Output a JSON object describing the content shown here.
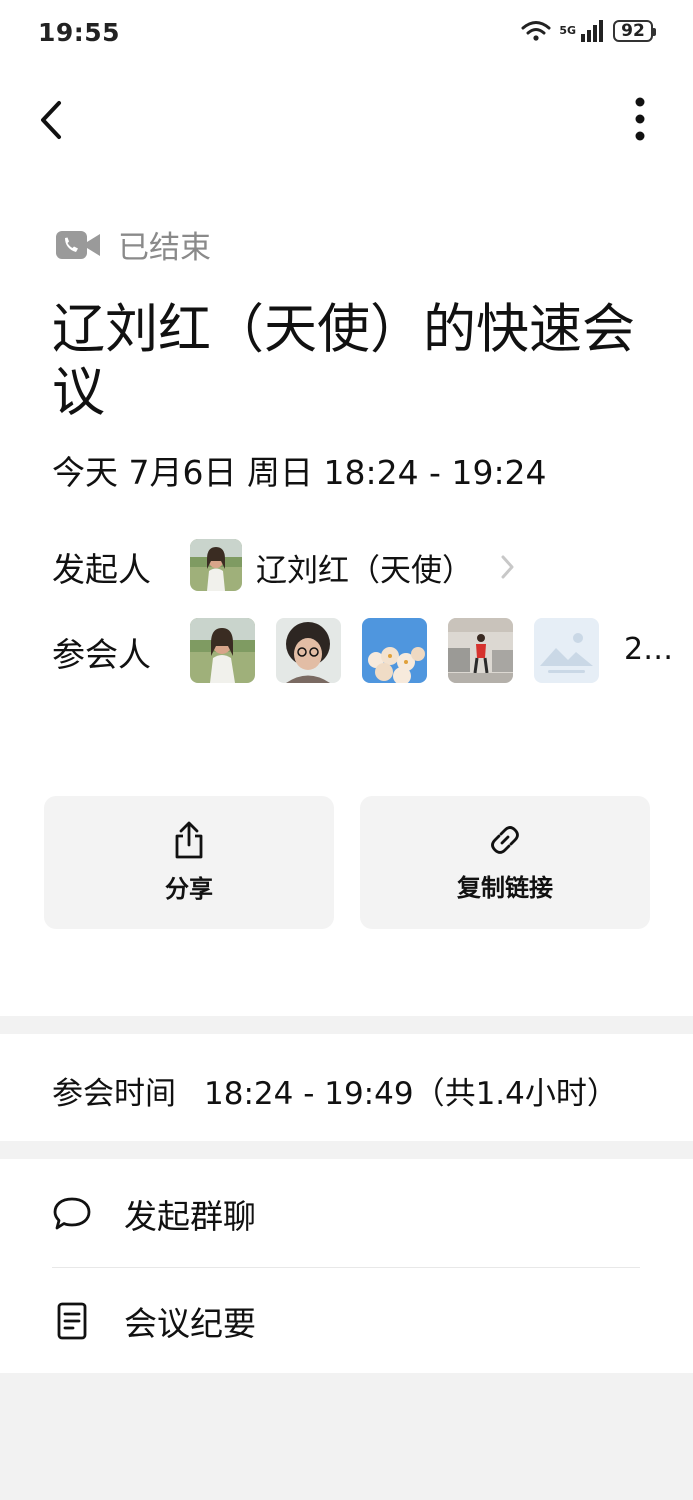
{
  "status_bar": {
    "time": "19:55",
    "network": "5G",
    "battery": "92"
  },
  "meeting": {
    "status_icon": "video-call-icon",
    "status_text": "已结束",
    "title": "辽刘红（天使）的快速会议",
    "date_line": "今天 7月6日 周日 18:24 - 19:24"
  },
  "host": {
    "label": "发起人",
    "name": "辽刘红（天使）"
  },
  "participants": {
    "label": "参会人",
    "more_text": "2…",
    "avatars": [
      "woman-praying-outdoors",
      "curly-hair-glasses",
      "white-flowers-sky",
      "person-in-office",
      "placeholder-image"
    ]
  },
  "actions": {
    "share_label": "分享",
    "copy_label": "复制链接"
  },
  "attend": {
    "label": "参会时间",
    "value": "18:24 - 19:49（共1.4小时）"
  },
  "menu": {
    "chat_label": "发起群聊",
    "notes_label": "会议纪要"
  },
  "colors": {
    "muted": "#8a8a8a",
    "card_bg": "#f3f3f3",
    "band_bg": "#f2f2f2"
  }
}
